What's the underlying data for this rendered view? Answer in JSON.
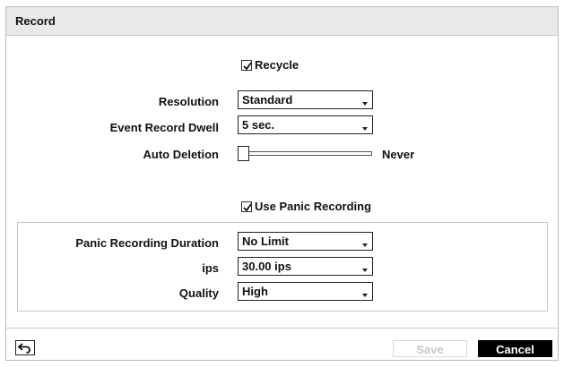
{
  "dialog": {
    "title": "Record"
  },
  "recycle": {
    "label": "Recycle",
    "checked": true
  },
  "resolution": {
    "label": "Resolution",
    "value": "Standard"
  },
  "event_record_dwell": {
    "label": "Event Record Dwell",
    "value": "5 sec."
  },
  "auto_deletion": {
    "label": "Auto Deletion",
    "value_text": "Never",
    "level": 0
  },
  "use_panic": {
    "label": "Use Panic Recording",
    "checked": true
  },
  "panic_duration": {
    "label": "Panic Recording Duration",
    "value": "No Limit"
  },
  "ips": {
    "label": "ips",
    "value": "30.00 ips"
  },
  "quality": {
    "label": "Quality",
    "value": "High"
  },
  "footer": {
    "back_icon": "undo-arrow-icon",
    "save_label": "Save",
    "cancel_label": "Cancel"
  }
}
